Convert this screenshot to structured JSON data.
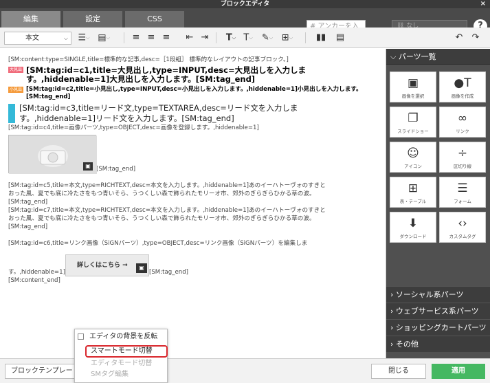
{
  "window": {
    "title": "ブロックエディタ",
    "close": "×"
  },
  "tabs": {
    "edit": "編集",
    "settings": "設定",
    "css": "CSS"
  },
  "anchor": {
    "placeholder": "# アンカーを入力"
  },
  "nav_select": {
    "value": "なし"
  },
  "toolbar": {
    "format": "本文"
  },
  "content": {
    "line1": "[SM:content:type=SINGLE,title=標準的な記事,desc=［1段組］ 標準的なレイアウトの記事ブロック。]",
    "badge_h1": "大見出",
    "h1": "[SM:tag:id=c1,title=大見出し,type=INPUT,desc=大見出しを入力しま す。,hiddenable=1]大見出しを入力します。[SM:tag_end]",
    "badge_h2": "小見出",
    "h2": "[SM:tag:id=c2,title=小見出し,type=INPUT,desc=小見出しを入力します。,hiddenable=1]小見出しを入力します。[SM:tag_end]",
    "lead": "[SM:tag:id=c3,title=リード文,type=TEXTAREA,desc=リード文を入力しま す。,hiddenable=1]リード文を入力します。[SM:tag_end]",
    "img_tag": "[SM:tag:id=c4,title=画像パーツ,type=OBJECT,desc=画像を登録します。,hiddenable=1]",
    "img_end": "[SM:tag_end]",
    "body5_1": "[SM:tag:id=c5,title=本文,type=RICHTEXT,desc=本文を入力します。,hiddenable=1]あのイーハトーヴォのすきと",
    "body5_2": "おった風、夏でも底に冷たさをもつ青いそら、うつくしい森で飾られたモリーオ市、郊外のぎらぎらひかる草の波。",
    "body5_end": "[SM:tag_end]",
    "body7_1": "[SM:tag:id=c7,title=本文,type=RICHTEXT,desc=本文を入力します。,hiddenable=1]あのイーハトーヴォのすきと",
    "body7_2": "おった風、夏でも底に冷たさをもつ青いそら、うつくしい森で飾られたモリーオ市、郊外のぎらぎらひかる草の波。",
    "body7_end": "[SM:tag_end]",
    "link_1": "[SM:tag:id=c6,title=リンク画像（SiGNパーツ）,type=OBJECT,desc=リンク画像（SiGNパーツ）を編集しま",
    "link_2": "す。,hiddenable=1]",
    "link_btn": "詳しくはこちら →",
    "link_end": "[SM:tag_end]",
    "content_end": "[SM:content_end]"
  },
  "sidebar": {
    "header": "パーツ一覧",
    "parts": [
      {
        "icon": "image-icon",
        "label": "画像を選択"
      },
      {
        "icon": "create-image-icon",
        "label": "画像を作成"
      },
      {
        "icon": "slideshow-icon",
        "label": "スライドショー"
      },
      {
        "icon": "link-icon",
        "label": "リンク"
      },
      {
        "icon": "smiley-icon",
        "label": "アイコン"
      },
      {
        "icon": "divider-icon",
        "label": "区切り線"
      },
      {
        "icon": "table-icon",
        "label": "表・テーブル"
      },
      {
        "icon": "form-icon",
        "label": "フォーム"
      },
      {
        "icon": "download-icon",
        "label": "ダウンロード"
      },
      {
        "icon": "code-icon",
        "label": "カスタムタグ"
      }
    ],
    "categories": [
      "ソーシャル系パーツ",
      "ウェブサービス系パーツ",
      "ショッピングカートパーツ",
      "その他"
    ]
  },
  "bottom": {
    "template": "ブロックテンプレート",
    "close": "閉じる",
    "apply": "適用"
  },
  "popup": {
    "invert": "エディタの背景を反転",
    "smart": "スマートモード切替",
    "editor": "エディタモード切替",
    "smtag": "SMタグ編集"
  },
  "colors": {
    "badge_h1": "#f06b7a",
    "badge_h2": "#f59a3a",
    "badge_lead": "#34b9d8",
    "apply": "#45b862",
    "highlight": "#d9262c"
  }
}
